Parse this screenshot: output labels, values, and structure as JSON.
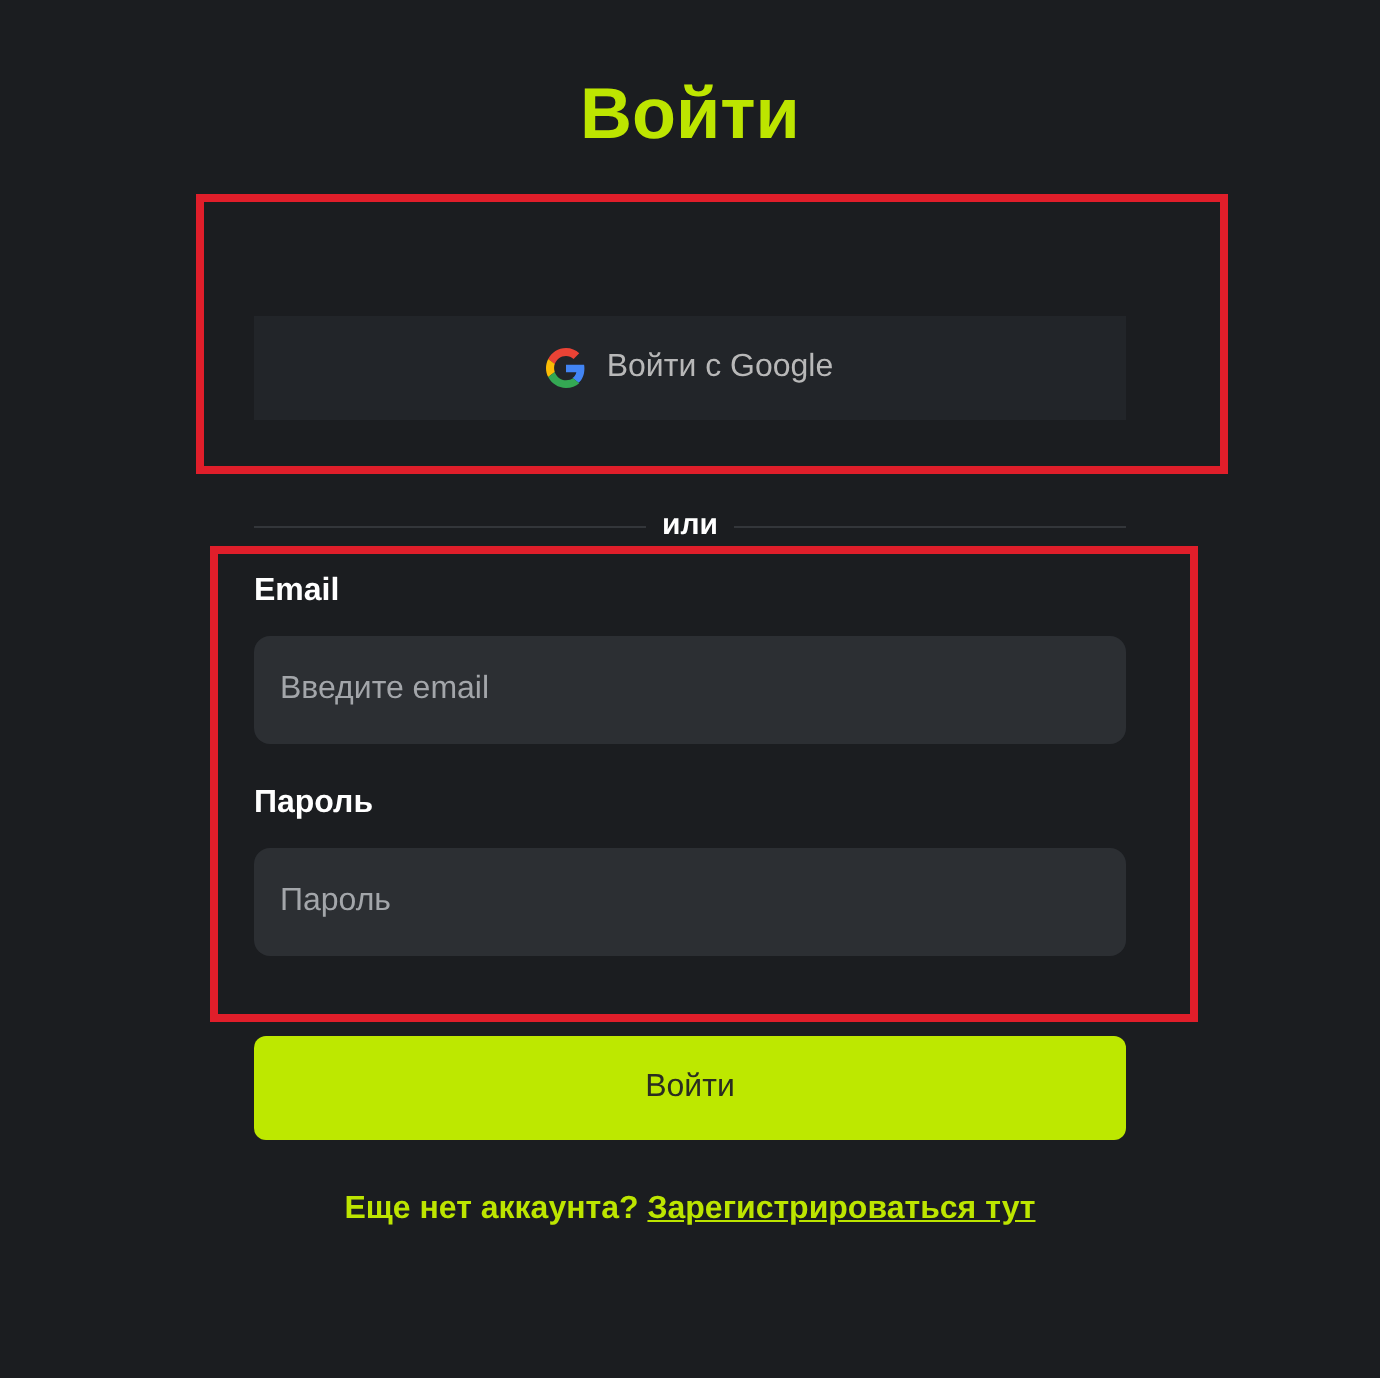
{
  "title": "Войти",
  "google_button": {
    "label": "Войти с Google"
  },
  "divider": {
    "label": "или"
  },
  "fields": [
    {
      "label": "Email",
      "placeholder": "Введите email"
    },
    {
      "label": "Пароль",
      "placeholder": "Пароль"
    }
  ],
  "submit_button": {
    "label": "Войти"
  },
  "footer": {
    "text": "Еще нет аккаунта?",
    "link": "Зарегистрироваться тут"
  }
}
